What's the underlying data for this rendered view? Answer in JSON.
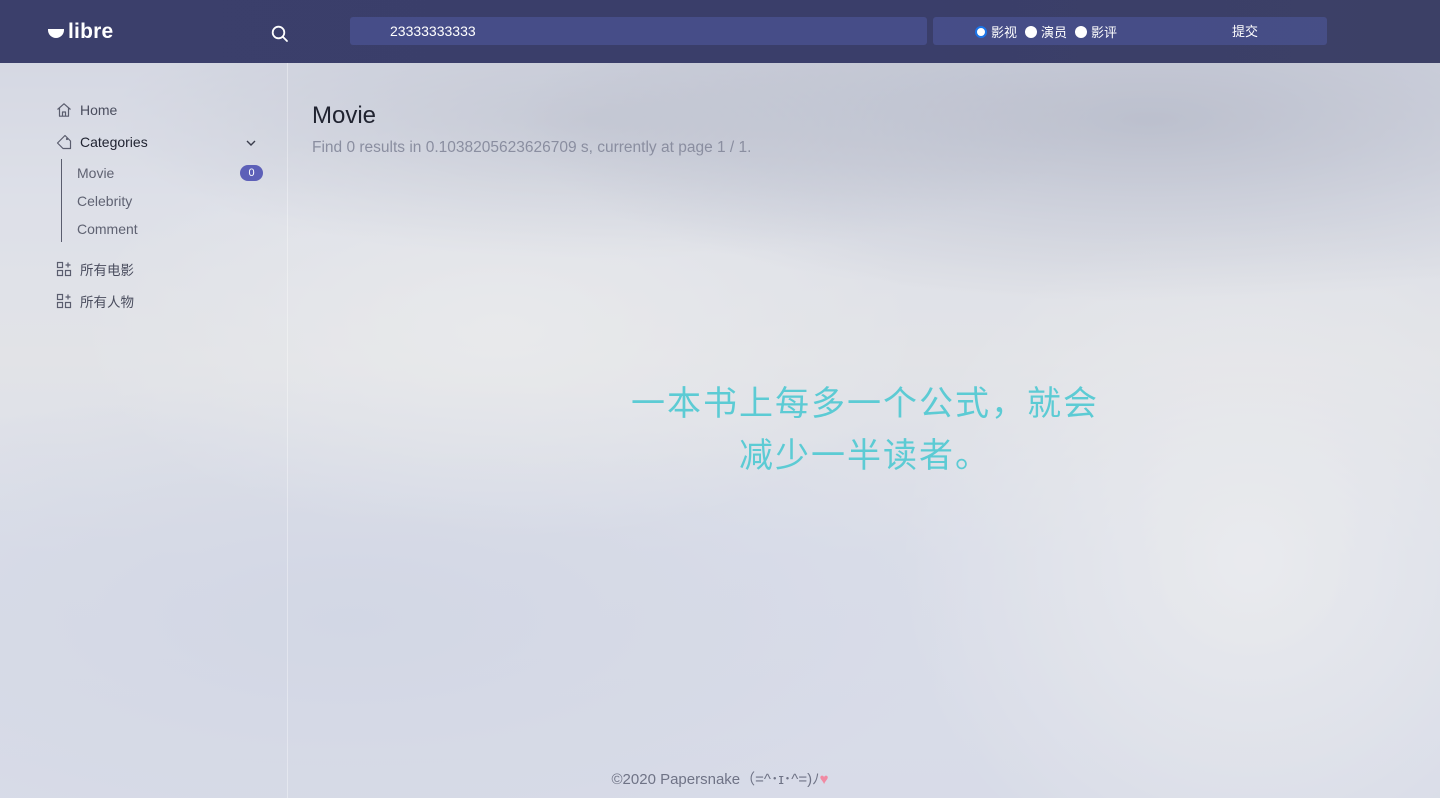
{
  "header": {
    "logo_text": "libre",
    "search_value": "23333333333",
    "search_types": [
      "影视",
      "演员",
      "影评"
    ],
    "selected_type": "影视",
    "submit_label": "提交"
  },
  "sidebar": {
    "home": "Home",
    "categories": "Categories",
    "sub_items": [
      {
        "label": "Movie",
        "badge": "0"
      },
      {
        "label": "Celebrity"
      },
      {
        "label": "Comment"
      }
    ],
    "all_movies": "所有电影",
    "all_people": "所有人物"
  },
  "main": {
    "title": "Movie",
    "info": "Find 0 results in 0.1038205623626709 s, currently at page 1 / 1."
  },
  "quote": {
    "line1": "一本书上每多一个公式，就会",
    "line2": "减少一半读者。"
  },
  "footer": {
    "text": "©2020 Papersnake（=^･ɪ･^=)ﾉ",
    "heart": "♥"
  },
  "colors": {
    "header_bg": "#3b3f6b",
    "badge": "#5d60b8",
    "quote": "#5ccbd4",
    "heart": "#f18aa3"
  }
}
